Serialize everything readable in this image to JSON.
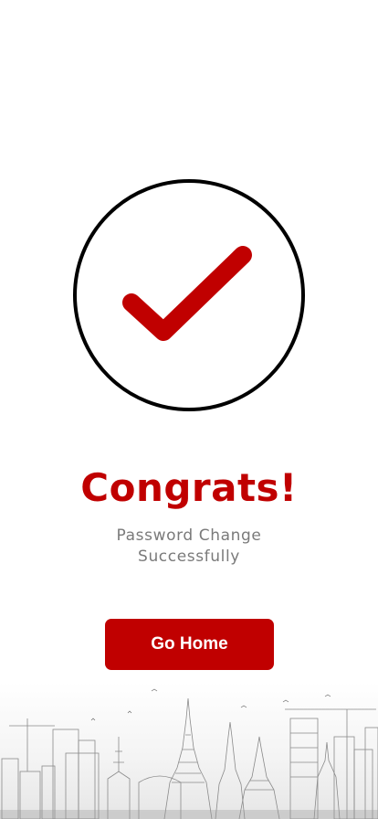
{
  "success_screen": {
    "icon": "check-circle-icon",
    "title": "Congrats!",
    "message_line1": "Password Change",
    "message_line2": "Successfully",
    "home_button_label": "Go Home"
  },
  "colors": {
    "accent": "#c00000",
    "circle_outline": "#000000",
    "message_text": "#7a7a7a",
    "background": "#ffffff"
  },
  "decoration": {
    "icon": "city-skyline-illustration"
  }
}
